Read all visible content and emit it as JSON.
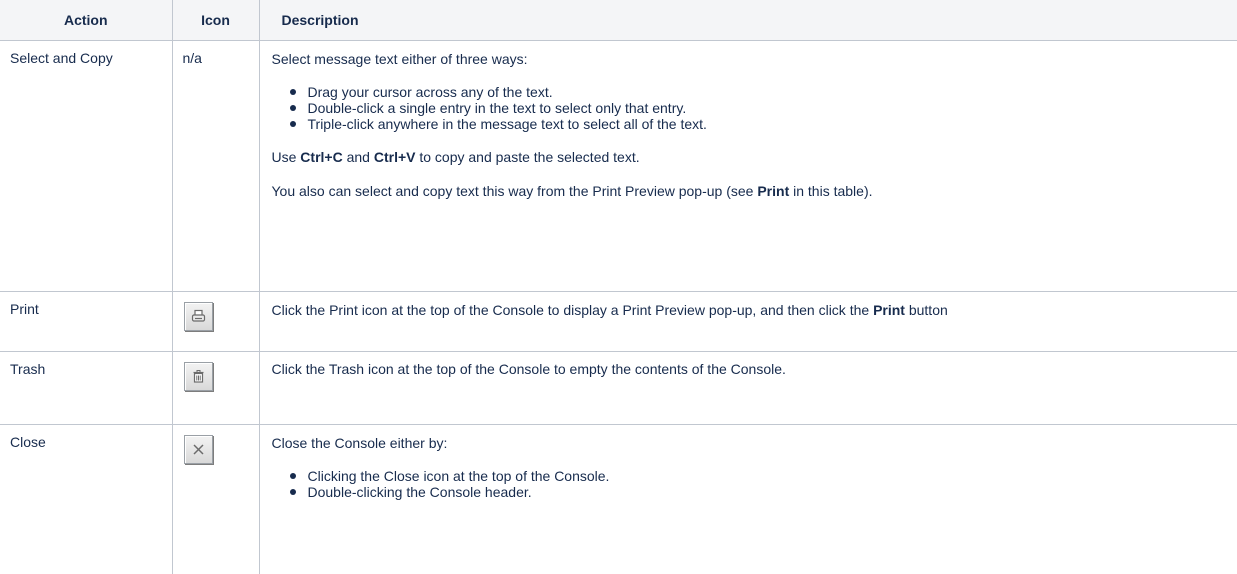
{
  "table": {
    "headers": {
      "action": "Action",
      "icon": "Icon",
      "description": "Description"
    },
    "rows": {
      "select": {
        "action": "Select and Copy",
        "icon_text": "n/a",
        "intro": "Select message text either of three ways:",
        "bullets": [
          "Drag your cursor across any of the text.",
          "Double-click a single entry in the text to select only that entry.",
          "Triple-click anywhere in the message text to select all of the text."
        ],
        "copy_p": {
          "a": "Use ",
          "b": "Ctrl+C",
          "c": " and ",
          "d": "Ctrl+V",
          "e": " to copy and paste the selected text."
        },
        "preview_p": {
          "a": "You also can select and copy text this way from the Print Preview pop-up (see ",
          "b": "Print",
          "c": " in this table)."
        }
      },
      "print": {
        "action": "Print",
        "icon": "print-icon",
        "desc": {
          "a": "Click the Print icon at the top of the Console to display a Print Preview pop-up, and then click the ",
          "b": "Print",
          "c": " button"
        }
      },
      "trash": {
        "action": "Trash",
        "icon": "trash-icon",
        "desc": "Click the Trash icon at the top of the Console to empty the contents of the Console."
      },
      "close": {
        "action": "Close",
        "icon": "close-icon",
        "intro": "Close the Console either by:",
        "bullets": [
          "Clicking the Close icon at the top of the Console.",
          "Double-clicking the Console header."
        ]
      }
    }
  }
}
